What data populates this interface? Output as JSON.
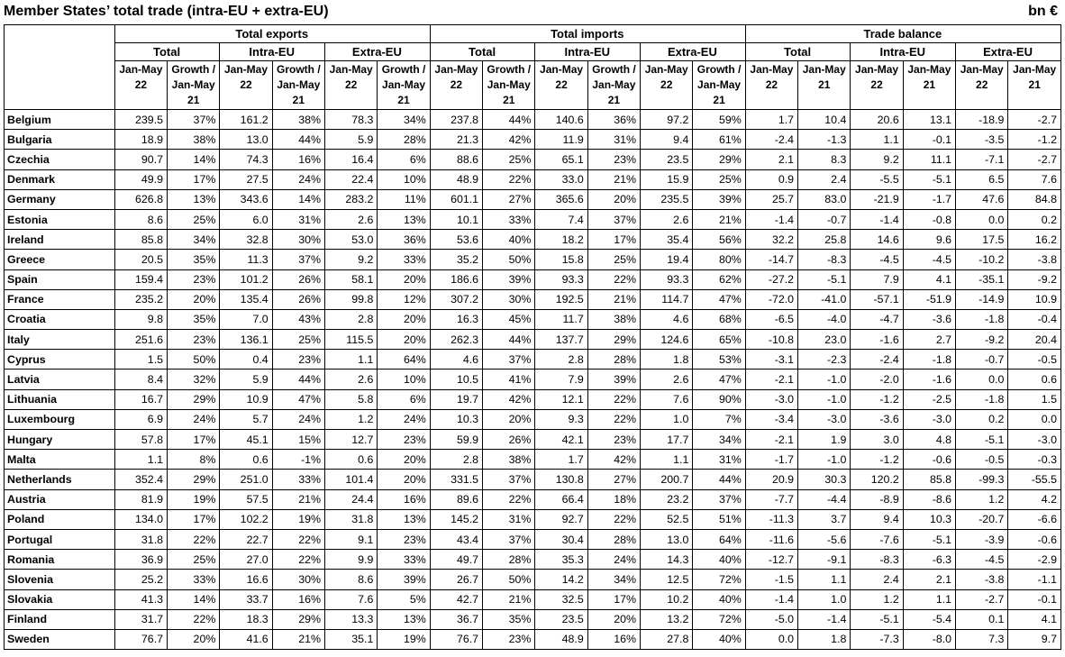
{
  "title": "Member States’ total trade (intra-EU + extra-EU)",
  "unit": "bn €",
  "header": {
    "groups": [
      "Total exports",
      "Total imports",
      "Trade balance"
    ],
    "sub_groups": [
      "Total",
      "Intra-EU",
      "Extra-EU",
      "Total",
      "Intra-EU",
      "Extra-EU",
      "Total",
      "Intra-EU",
      "Extra-EU"
    ],
    "columns": [
      "Jan-May 22",
      "Growth / Jan-May 21",
      "Jan-May 22",
      "Growth / Jan-May 21",
      "Jan-May 22",
      "Growth / Jan-May 21",
      "Jan-May 22",
      "Growth / Jan-May 21",
      "Jan-May 22",
      "Growth / Jan-May 21",
      "Jan-May 22",
      "Growth / Jan-May 21",
      "Jan-May 22",
      "Jan-May 21",
      "Jan-May 22",
      "Jan-May 21",
      "Jan-May 22",
      "Jan-May 21"
    ]
  },
  "rows": [
    [
      "Belgium",
      "239.5",
      "37%",
      "161.2",
      "38%",
      "78.3",
      "34%",
      "237.8",
      "44%",
      "140.6",
      "36%",
      "97.2",
      "59%",
      "1.7",
      "10.4",
      "20.6",
      "13.1",
      "-18.9",
      "-2.7"
    ],
    [
      "Bulgaria",
      "18.9",
      "38%",
      "13.0",
      "44%",
      "5.9",
      "28%",
      "21.3",
      "42%",
      "11.9",
      "31%",
      "9.4",
      "61%",
      "-2.4",
      "-1.3",
      "1.1",
      "-0.1",
      "-3.5",
      "-1.2"
    ],
    [
      "Czechia",
      "90.7",
      "14%",
      "74.3",
      "16%",
      "16.4",
      "6%",
      "88.6",
      "25%",
      "65.1",
      "23%",
      "23.5",
      "29%",
      "2.1",
      "8.3",
      "9.2",
      "11.1",
      "-7.1",
      "-2.7"
    ],
    [
      "Denmark",
      "49.9",
      "17%",
      "27.5",
      "24%",
      "22.4",
      "10%",
      "48.9",
      "22%",
      "33.0",
      "21%",
      "15.9",
      "25%",
      "0.9",
      "2.4",
      "-5.5",
      "-5.1",
      "6.5",
      "7.6"
    ],
    [
      "Germany",
      "626.8",
      "13%",
      "343.6",
      "14%",
      "283.2",
      "11%",
      "601.1",
      "27%",
      "365.6",
      "20%",
      "235.5",
      "39%",
      "25.7",
      "83.0",
      "-21.9",
      "-1.7",
      "47.6",
      "84.8"
    ],
    [
      "Estonia",
      "8.6",
      "25%",
      "6.0",
      "31%",
      "2.6",
      "13%",
      "10.1",
      "33%",
      "7.4",
      "37%",
      "2.6",
      "21%",
      "-1.4",
      "-0.7",
      "-1.4",
      "-0.8",
      "0.0",
      "0.2"
    ],
    [
      "Ireland",
      "85.8",
      "34%",
      "32.8",
      "30%",
      "53.0",
      "36%",
      "53.6",
      "40%",
      "18.2",
      "17%",
      "35.4",
      "56%",
      "32.2",
      "25.8",
      "14.6",
      "9.6",
      "17.5",
      "16.2"
    ],
    [
      "Greece",
      "20.5",
      "35%",
      "11.3",
      "37%",
      "9.2",
      "33%",
      "35.2",
      "50%",
      "15.8",
      "25%",
      "19.4",
      "80%",
      "-14.7",
      "-8.3",
      "-4.5",
      "-4.5",
      "-10.2",
      "-3.8"
    ],
    [
      "Spain",
      "159.4",
      "23%",
      "101.2",
      "26%",
      "58.1",
      "20%",
      "186.6",
      "39%",
      "93.3",
      "22%",
      "93.3",
      "62%",
      "-27.2",
      "-5.1",
      "7.9",
      "4.1",
      "-35.1",
      "-9.2"
    ],
    [
      "France",
      "235.2",
      "20%",
      "135.4",
      "26%",
      "99.8",
      "12%",
      "307.2",
      "30%",
      "192.5",
      "21%",
      "114.7",
      "47%",
      "-72.0",
      "-41.0",
      "-57.1",
      "-51.9",
      "-14.9",
      "10.9"
    ],
    [
      "Croatia",
      "9.8",
      "35%",
      "7.0",
      "43%",
      "2.8",
      "20%",
      "16.3",
      "45%",
      "11.7",
      "38%",
      "4.6",
      "68%",
      "-6.5",
      "-4.0",
      "-4.7",
      "-3.6",
      "-1.8",
      "-0.4"
    ],
    [
      "Italy",
      "251.6",
      "23%",
      "136.1",
      "25%",
      "115.5",
      "20%",
      "262.3",
      "44%",
      "137.7",
      "29%",
      "124.6",
      "65%",
      "-10.8",
      "23.0",
      "-1.6",
      "2.7",
      "-9.2",
      "20.4"
    ],
    [
      "Cyprus",
      "1.5",
      "50%",
      "0.4",
      "23%",
      "1.1",
      "64%",
      "4.6",
      "37%",
      "2.8",
      "28%",
      "1.8",
      "53%",
      "-3.1",
      "-2.3",
      "-2.4",
      "-1.8",
      "-0.7",
      "-0.5"
    ],
    [
      "Latvia",
      "8.4",
      "32%",
      "5.9",
      "44%",
      "2.6",
      "10%",
      "10.5",
      "41%",
      "7.9",
      "39%",
      "2.6",
      "47%",
      "-2.1",
      "-1.0",
      "-2.0",
      "-1.6",
      "0.0",
      "0.6"
    ],
    [
      "Lithuania",
      "16.7",
      "29%",
      "10.9",
      "47%",
      "5.8",
      "6%",
      "19.7",
      "42%",
      "12.1",
      "22%",
      "7.6",
      "90%",
      "-3.0",
      "-1.0",
      "-1.2",
      "-2.5",
      "-1.8",
      "1.5"
    ],
    [
      "Luxembourg",
      "6.9",
      "24%",
      "5.7",
      "24%",
      "1.2",
      "24%",
      "10.3",
      "20%",
      "9.3",
      "22%",
      "1.0",
      "7%",
      "-3.4",
      "-3.0",
      "-3.6",
      "-3.0",
      "0.2",
      "0.0"
    ],
    [
      "Hungary",
      "57.8",
      "17%",
      "45.1",
      "15%",
      "12.7",
      "23%",
      "59.9",
      "26%",
      "42.1",
      "23%",
      "17.7",
      "34%",
      "-2.1",
      "1.9",
      "3.0",
      "4.8",
      "-5.1",
      "-3.0"
    ],
    [
      "Malta",
      "1.1",
      "8%",
      "0.6",
      "-1%",
      "0.6",
      "20%",
      "2.8",
      "38%",
      "1.7",
      "42%",
      "1.1",
      "31%",
      "-1.7",
      "-1.0",
      "-1.2",
      "-0.6",
      "-0.5",
      "-0.3"
    ],
    [
      "Netherlands",
      "352.4",
      "29%",
      "251.0",
      "33%",
      "101.4",
      "20%",
      "331.5",
      "37%",
      "130.8",
      "27%",
      "200.7",
      "44%",
      "20.9",
      "30.3",
      "120.2",
      "85.8",
      "-99.3",
      "-55.5"
    ],
    [
      "Austria",
      "81.9",
      "19%",
      "57.5",
      "21%",
      "24.4",
      "16%",
      "89.6",
      "22%",
      "66.4",
      "18%",
      "23.2",
      "37%",
      "-7.7",
      "-4.4",
      "-8.9",
      "-8.6",
      "1.2",
      "4.2"
    ],
    [
      "Poland",
      "134.0",
      "17%",
      "102.2",
      "19%",
      "31.8",
      "13%",
      "145.2",
      "31%",
      "92.7",
      "22%",
      "52.5",
      "51%",
      "-11.3",
      "3.7",
      "9.4",
      "10.3",
      "-20.7",
      "-6.6"
    ],
    [
      "Portugal",
      "31.8",
      "22%",
      "22.7",
      "22%",
      "9.1",
      "23%",
      "43.4",
      "37%",
      "30.4",
      "28%",
      "13.0",
      "64%",
      "-11.6",
      "-5.6",
      "-7.6",
      "-5.1",
      "-3.9",
      "-0.6"
    ],
    [
      "Romania",
      "36.9",
      "25%",
      "27.0",
      "22%",
      "9.9",
      "33%",
      "49.7",
      "28%",
      "35.3",
      "24%",
      "14.3",
      "40%",
      "-12.7",
      "-9.1",
      "-8.3",
      "-6.3",
      "-4.5",
      "-2.9"
    ],
    [
      "Slovenia",
      "25.2",
      "33%",
      "16.6",
      "30%",
      "8.6",
      "39%",
      "26.7",
      "50%",
      "14.2",
      "34%",
      "12.5",
      "72%",
      "-1.5",
      "1.1",
      "2.4",
      "2.1",
      "-3.8",
      "-1.1"
    ],
    [
      "Slovakia",
      "41.3",
      "14%",
      "33.7",
      "16%",
      "7.6",
      "5%",
      "42.7",
      "21%",
      "32.5",
      "17%",
      "10.2",
      "40%",
      "-1.4",
      "1.0",
      "1.2",
      "1.1",
      "-2.7",
      "-0.1"
    ],
    [
      "Finland",
      "31.7",
      "22%",
      "18.3",
      "29%",
      "13.3",
      "13%",
      "36.7",
      "35%",
      "23.5",
      "20%",
      "13.2",
      "72%",
      "-5.0",
      "-1.4",
      "-5.1",
      "-5.4",
      "0.1",
      "4.1"
    ],
    [
      "Sweden",
      "76.7",
      "20%",
      "41.6",
      "21%",
      "35.1",
      "19%",
      "76.7",
      "23%",
      "48.9",
      "16%",
      "27.8",
      "40%",
      "0.0",
      "1.8",
      "-7.3",
      "-8.0",
      "7.3",
      "9.7"
    ]
  ]
}
